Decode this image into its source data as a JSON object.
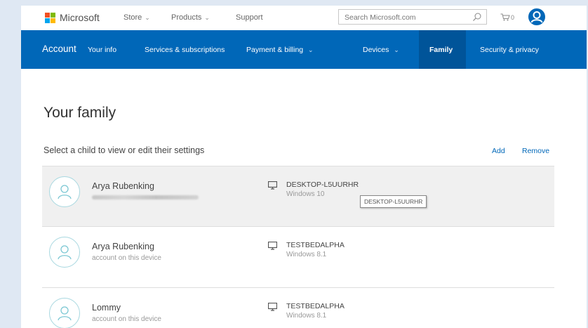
{
  "header": {
    "brand": "Microsoft",
    "nav": [
      {
        "label": "Store",
        "has_menu": true
      },
      {
        "label": "Products",
        "has_menu": true
      },
      {
        "label": "Support",
        "has_menu": false
      }
    ],
    "search_placeholder": "Search Microsoft.com",
    "cart_count": "0"
  },
  "account_nav": {
    "title": "Account",
    "items": [
      {
        "label": "Your info"
      },
      {
        "label": "Services & subscriptions"
      },
      {
        "label": "Payment & billing",
        "has_menu": true
      },
      {
        "label": "Devices",
        "has_menu": true
      },
      {
        "label": "Family",
        "active": true
      },
      {
        "label": "Security & privacy"
      }
    ]
  },
  "main": {
    "title": "Your family",
    "subtitle": "Select a child to view or edit their settings",
    "actions": {
      "add": "Add",
      "remove": "Remove"
    },
    "members": [
      {
        "name": "Arya Rubenking",
        "sub": "",
        "device": "DESKTOP-L5UURHR",
        "os": "Windows 10",
        "selected": true,
        "tooltip": "DESKTOP-L5UURHR"
      },
      {
        "name": "Arya Rubenking",
        "sub": "account on this device",
        "device": "TESTBEDALPHA",
        "os": "Windows 8.1"
      },
      {
        "name": "Lommy",
        "sub": "account on this device",
        "device": "TESTBEDALPHA",
        "os": "Windows 8.1"
      }
    ]
  },
  "colors": {
    "accent": "#0067b8",
    "active_tab": "#005499",
    "selected_row": "#f0f0f0"
  },
  "icons": {
    "search": "search-icon",
    "cart": "cart-icon",
    "user": "user-icon",
    "device": "monitor-icon"
  }
}
